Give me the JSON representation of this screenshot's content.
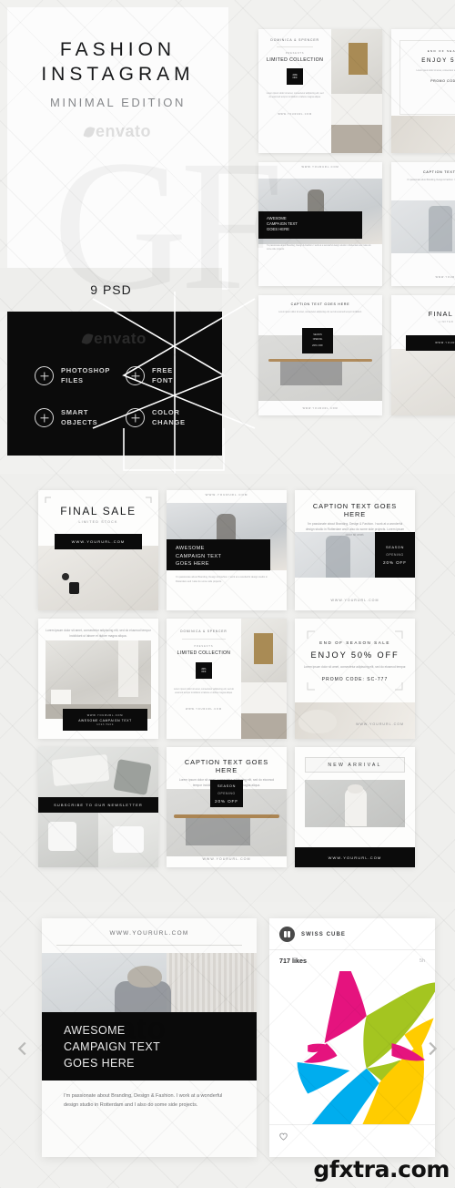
{
  "cover": {
    "line1": "FASHION",
    "line2": "INSTAGRAM",
    "subtitle": "MINIMAL EDITION",
    "watermark": "envato"
  },
  "psd": {
    "count_label": "9 PSD"
  },
  "features": [
    {
      "label": "PHOTOSHOP\nFILES",
      "icon": "plus-icon"
    },
    {
      "label": "FREE\nFONT",
      "icon": "plus-icon"
    },
    {
      "label": "SMART\nOBJECTS",
      "icon": "plus-icon"
    },
    {
      "label": "COLOR\nCHANGE",
      "icon": "plus-icon"
    }
  ],
  "templates": {
    "brand": "DOMINICA & SPENCER",
    "presents": "PRESENTS",
    "limited_collection": "LIMITED COLLECTION",
    "discount_badge_1": "20%",
    "discount_badge_2": "OFF",
    "url": "WWW.YOURURL.COM",
    "url_lower": "www.yoururl.com",
    "end_of_season": "END OF SEASON SALE",
    "enjoy": "ENJOY 50% OFF",
    "promo": "PROMO CODE: SC-777",
    "awesome_l1": "AWESOME",
    "awesome_l2": "CAMPAIGN TEXT",
    "awesome_l3": "GOES HERE",
    "caption_title": "CAPTION TEXT GOES HERE",
    "final_sale": "FINAL SALE",
    "limited_stock": "LIMITED STOCK",
    "season": "SEASON",
    "opening": "OPENING",
    "twenty_off": "20% OFF",
    "newsletter": "SUBSCRIBE TO OUR NEWSLETTER",
    "new_arrival": "NEW ARRIVAL",
    "body_text": "Lorem ipsum dolor sit amet, consectetur adipiscing elit, sed do eiusmod tempor incididunt ut labore et dolore magna aliqua.",
    "bio_short": "I'm passionate about Branding, Design & Fashion. I work at a wonderful design studio in Rotterdam and I also do some side projects."
  },
  "showcase": {
    "url": "WWW.YOURURL.COM",
    "headline_l1": "AWESOME",
    "headline_l2": "CAMPAIGN TEXT",
    "headline_l3": "GOES HERE",
    "caption": "I'm passionate about Branding, Design & Fashion. I work at a wonderful design studio in Rotterdam and I also do some side projects."
  },
  "instagram": {
    "account": "SWISS CUBE",
    "likes": "717 likes",
    "time": "5h",
    "avatar_icon": "pause-avatar-icon",
    "like_icon": "heart-icon",
    "colors": {
      "magenta": "#E5137E",
      "green": "#A4C520",
      "cyan": "#00ADEE",
      "yellow": "#FFCC00"
    }
  },
  "nav": {
    "prev_icon": "chevron-left-icon",
    "next_icon": "chevron-right-icon"
  },
  "watermark": {
    "site": "gfxtra.com",
    "envato": "envato"
  },
  "theme": {
    "page_bg": "#f1f1ef",
    "card_bg": "#ffffff",
    "black": "#0b0b0b",
    "text": "#1b1c1e",
    "muted": "#9a9b9e"
  }
}
